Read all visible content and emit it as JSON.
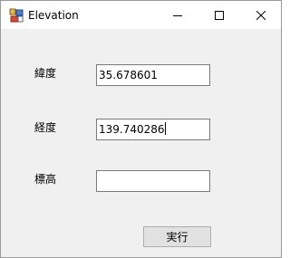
{
  "window": {
    "title": "Elevation"
  },
  "form": {
    "latitude_label": "緯度",
    "latitude_value": "35.678601",
    "longitude_label": "経度",
    "longitude_value": "139.740286",
    "elevation_label": "標高",
    "elevation_value": "",
    "execute_label": "実行"
  }
}
